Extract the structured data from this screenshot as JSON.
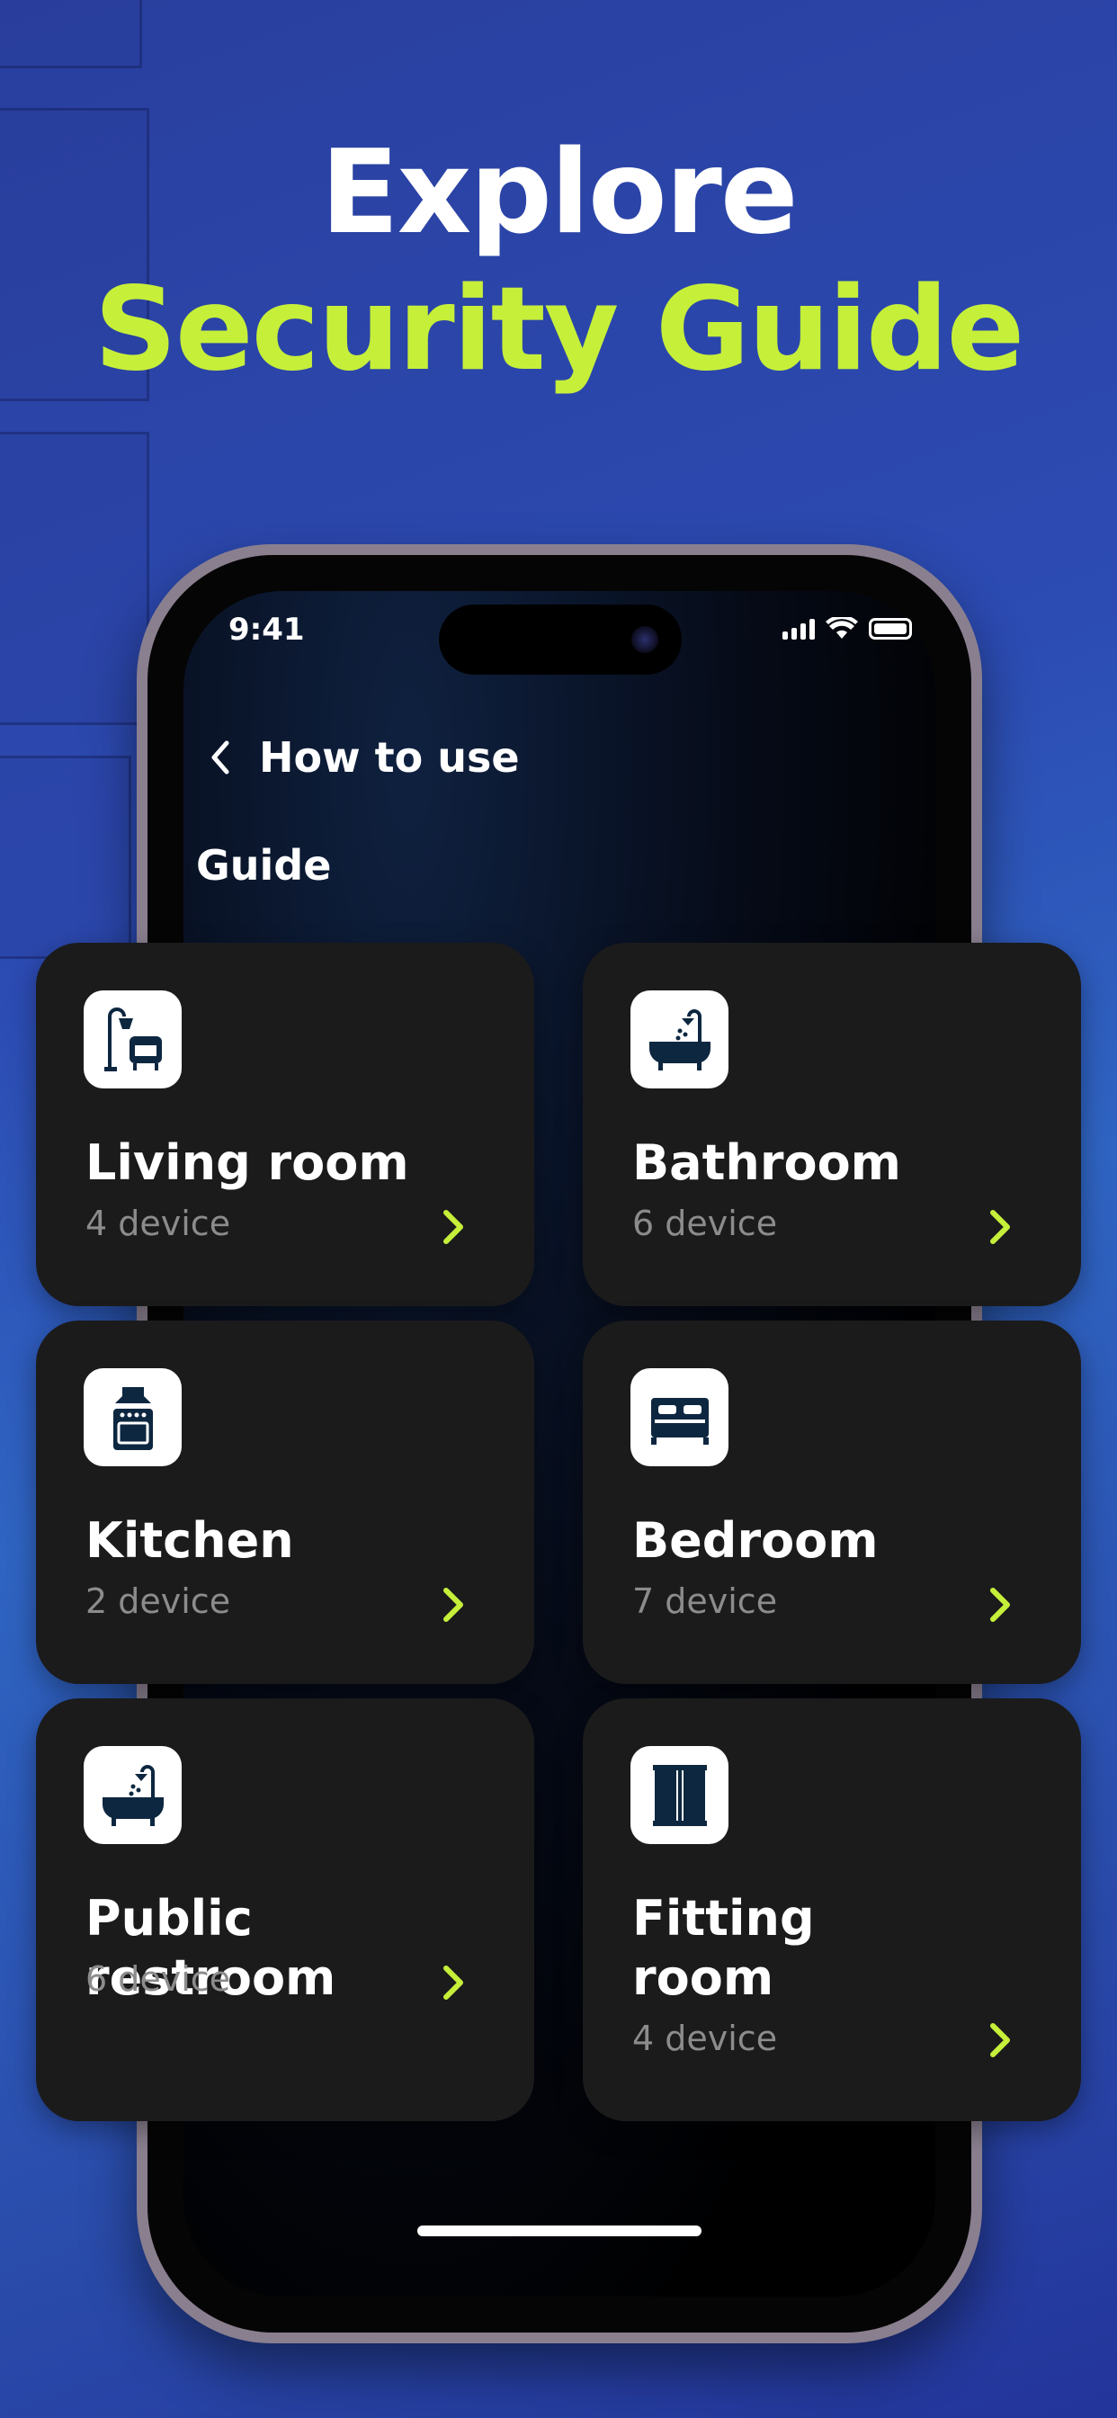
{
  "headline": {
    "line1": "Explore",
    "line2": "Security Guide",
    "line1_color": "#ffffff",
    "line2_color": "#c6ef3a"
  },
  "status_bar": {
    "time": "9:41",
    "icons": [
      "cellular-signal-icon",
      "wifi-icon",
      "battery-icon"
    ]
  },
  "nav": {
    "back_icon": "chevron-left-icon",
    "title": "How to use"
  },
  "section": {
    "title": "Guide"
  },
  "rooms": [
    {
      "name": "Living room",
      "count": "4 device",
      "icon": "living-room-icon"
    },
    {
      "name": "Bathroom",
      "count": "6 device",
      "icon": "bathtub-icon"
    },
    {
      "name": "Kitchen",
      "count": "2 device",
      "icon": "stove-icon"
    },
    {
      "name": "Bedroom",
      "count": "7 device",
      "icon": "bed-icon"
    },
    {
      "name": "Public restroom",
      "count": "6 device",
      "icon": "bathtub-icon"
    },
    {
      "name": "Fitting room",
      "count": "4 device",
      "icon": "fitting-room-icon"
    }
  ],
  "colors": {
    "accent": "#c6ef3a",
    "card_bg": "#1b1b1c",
    "icon_fg": "#0d2740",
    "muted_text": "#8c8c8c"
  }
}
